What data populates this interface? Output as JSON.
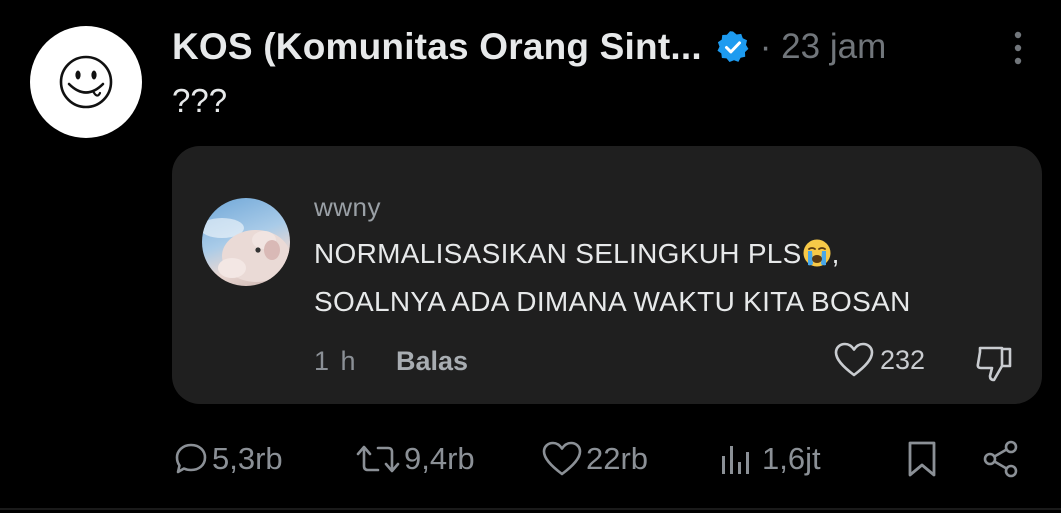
{
  "post": {
    "author_name": "KOS (Komunitas Orang Sint...",
    "verified": true,
    "time": "· 23 jam",
    "text": "???",
    "avatar_icon": "smiley-face-icon",
    "colors": {
      "background": "#000000",
      "verified": "#1d9bf0",
      "quote_bg": "#1f1f1f",
      "muted": "#71767b"
    }
  },
  "quoted_comment": {
    "username": "wwny",
    "line1": "NORMALISASIKAN SELINGKUH PLS",
    "line1_suffix": ",",
    "emoji": "loudly-crying-face-emoji",
    "line2": "SOALNYA ADA DIMANA WAKTU KITA BOSAN",
    "time": "1 h",
    "reply_label": "Balas",
    "like_count": "232"
  },
  "actions": {
    "replies": "5,3rb",
    "reposts": "9,4rb",
    "likes": "22rb",
    "views": "1,6jt"
  }
}
